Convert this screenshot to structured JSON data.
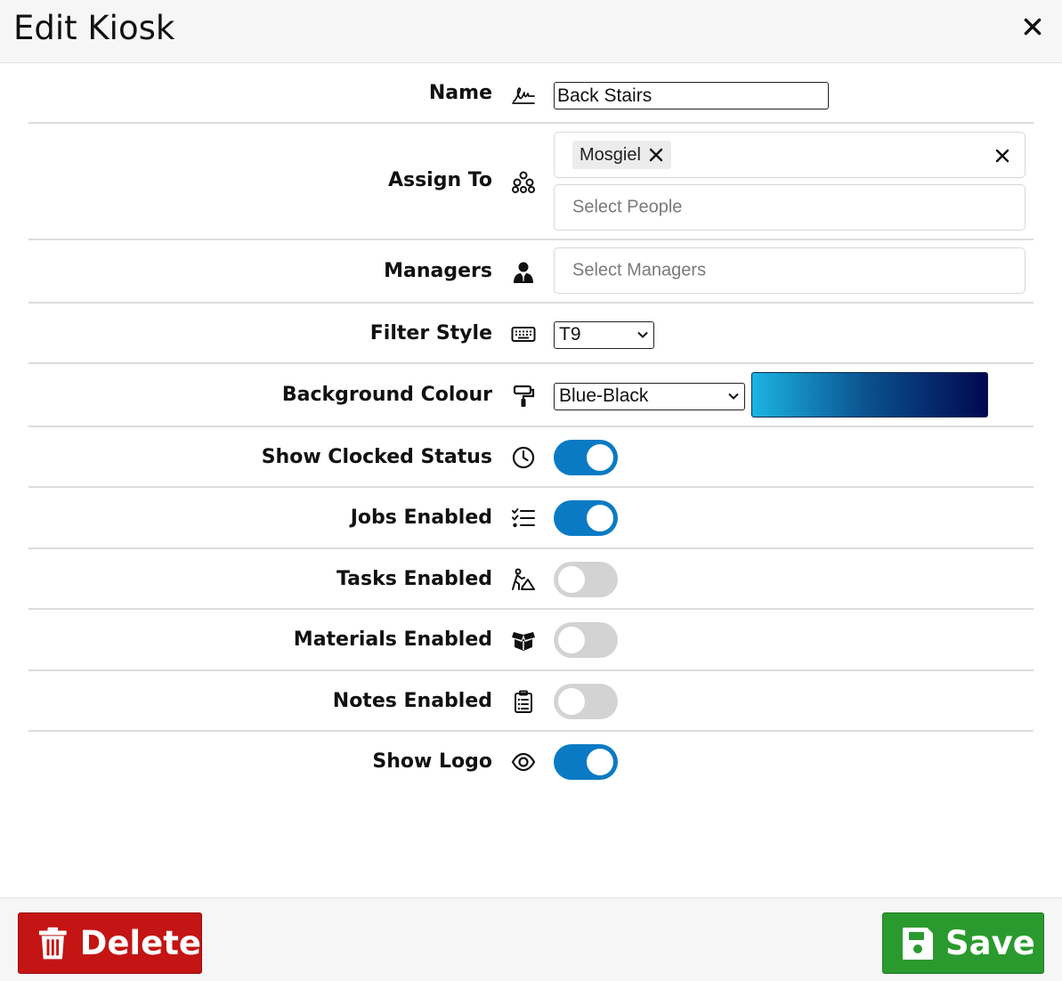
{
  "header": {
    "title": "Edit Kiosk",
    "close_icon": "close-icon"
  },
  "form": {
    "name": {
      "label": "Name",
      "icon": "signature-icon",
      "value": "Back Stairs"
    },
    "assign_to": {
      "label": "Assign To",
      "icon": "sitemap-icon",
      "chips": [
        "Mosgiel"
      ],
      "people_placeholder": "Select People"
    },
    "managers": {
      "label": "Managers",
      "icon": "user-tie-icon",
      "placeholder": "Select Managers"
    },
    "filter_style": {
      "label": "Filter Style",
      "icon": "keyboard-icon",
      "value": "T9"
    },
    "background_colour": {
      "label": "Background Colour",
      "icon": "paint-roller-icon",
      "value": "Blue-Black",
      "gradient": [
        "#1bb4e2",
        "#0a4f8c",
        "#020850"
      ]
    },
    "show_clocked_status": {
      "label": "Show Clocked Status",
      "icon": "clock-icon",
      "on": true
    },
    "jobs_enabled": {
      "label": "Jobs Enabled",
      "icon": "list-check-icon",
      "on": true
    },
    "tasks_enabled": {
      "label": "Tasks Enabled",
      "icon": "person-digging-icon",
      "on": false
    },
    "materials_enabled": {
      "label": "Materials Enabled",
      "icon": "box-open-icon",
      "on": false
    },
    "notes_enabled": {
      "label": "Notes Enabled",
      "icon": "clipboard-list-icon",
      "on": false
    },
    "show_logo": {
      "label": "Show Logo",
      "icon": "eye-icon",
      "on": true
    }
  },
  "footer": {
    "delete_label": "Delete",
    "save_label": "Save"
  },
  "colors": {
    "toggle_on": "#0a7ac4",
    "toggle_off": "#d3d3d3",
    "delete": "#c41414",
    "save": "#2a9a2e"
  }
}
